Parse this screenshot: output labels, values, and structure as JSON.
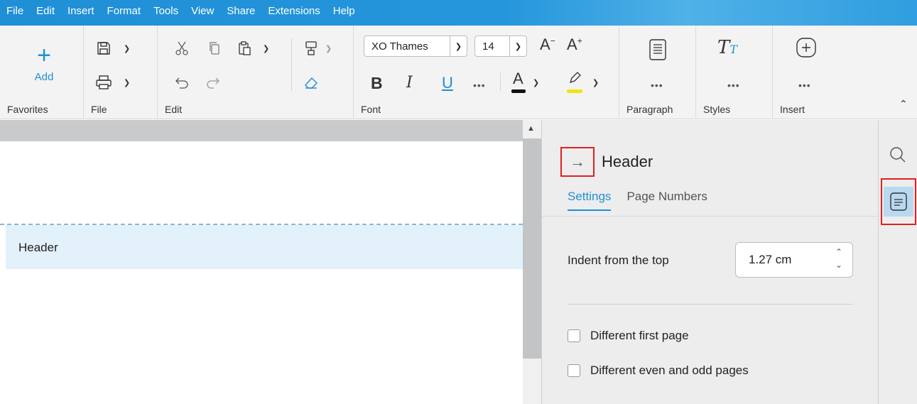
{
  "menu": [
    "File",
    "Edit",
    "Insert",
    "Format",
    "Tools",
    "View",
    "Share",
    "Extensions",
    "Help"
  ],
  "ribbon": {
    "favorites": {
      "add_label": "Add",
      "group_label": "Favorites"
    },
    "file": {
      "group_label": "File"
    },
    "edit": {
      "group_label": "Edit"
    },
    "font": {
      "group_label": "Font",
      "font_name": "XO Thames",
      "font_size": "14",
      "bold": "B",
      "italic": "I",
      "underline": "U",
      "more": "•••",
      "font_color_letter": "A",
      "font_color": "#111111",
      "highlight_color": "#f3e40f"
    },
    "paragraph": {
      "group_label": "Paragraph",
      "more": "•••"
    },
    "styles": {
      "group_label": "Styles",
      "more": "•••"
    },
    "insert": {
      "group_label": "Insert",
      "more": "•••"
    }
  },
  "document": {
    "header_text": "Header"
  },
  "pane": {
    "title": "Header",
    "tabs": [
      {
        "label": "Settings",
        "active": true
      },
      {
        "label": "Page Numbers",
        "active": false
      }
    ],
    "indent_label": "Indent from the top",
    "indent_value": "1.27 cm",
    "checkboxes": [
      {
        "label": "Different first page",
        "checked": false
      },
      {
        "label": "Different even and odd pages",
        "checked": false
      }
    ]
  },
  "colors": {
    "accent": "#1f8fd6",
    "highlight_box": "#e02020"
  }
}
